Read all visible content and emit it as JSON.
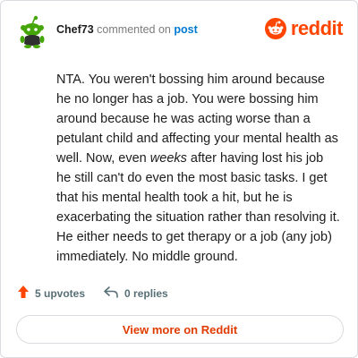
{
  "header": {
    "username": "Chef73",
    "commented_on_text": "commented on",
    "post_link": "post",
    "brand_wordmark": "reddit"
  },
  "comment": {
    "segment_1": "NTA. You weren't bossing him around because he no longer has a job. You were bossing him around because he was acting worse than a petulant child and affecting your mental health as well. Now, even ",
    "segment_emphasis": "weeks",
    "segment_2": " after having lost his job he still can't do even the most basic tasks. I get that his mental health took a hit, but he is exacerbating the situation rather than resolving it. He either needs to get therapy or a job (any job) immediately. No middle ground."
  },
  "actions": {
    "upvotes": "5 upvotes",
    "replies": "0 replies"
  },
  "footer": {
    "view_more": "View more on Reddit"
  },
  "colors": {
    "brand": "#ff4500",
    "link": "#0079d3",
    "avatar_green": "#46a508",
    "button_text": "#e03c00"
  },
  "icons": {
    "avatar": "snoo-avatar-icon",
    "brand": "reddit-logo-icon",
    "upvote": "upvote-arrow-icon",
    "reply": "reply-arrow-icon"
  }
}
